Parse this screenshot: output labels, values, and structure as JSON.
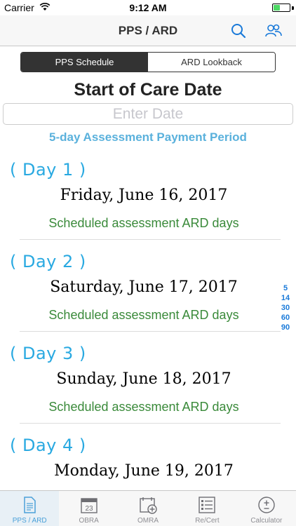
{
  "status": {
    "carrier": "Carrier",
    "time": "9:12 AM",
    "battery_level": 0.4
  },
  "nav": {
    "title": "PPS / ARD",
    "icons": [
      "search-icon",
      "people-icon"
    ]
  },
  "segments": [
    {
      "label": "PPS Schedule",
      "active": true
    },
    {
      "label": "ARD Lookback",
      "active": false
    }
  ],
  "main": {
    "title": "Start of Care Date",
    "date_placeholder": "Enter Date",
    "date_value": "",
    "period": "5-day Assessment Payment Period"
  },
  "days": [
    {
      "label": "( Day  1 )",
      "date": "Friday, June 16, 2017",
      "note": "Scheduled assessment ARD days"
    },
    {
      "label": "( Day  2 )",
      "date": "Saturday, June 17, 2017",
      "note": "Scheduled assessment ARD days"
    },
    {
      "label": "( Day  3 )",
      "date": "Sunday, June 18, 2017",
      "note": "Scheduled assessment ARD days"
    },
    {
      "label": "( Day  4 )",
      "date": "Monday, June 19, 2017",
      "note": ""
    }
  ],
  "index": [
    "5",
    "14",
    "30",
    "60",
    "90"
  ],
  "tabs": [
    {
      "label": "PPS / ARD",
      "icon": "document-icon",
      "active": true
    },
    {
      "label": "OBRA",
      "icon": "calendar-icon",
      "active": false,
      "badge": "23"
    },
    {
      "label": "OMRA",
      "icon": "calendar-add-icon",
      "active": false
    },
    {
      "label": "Re/Cert",
      "icon": "list-icon",
      "active": false
    },
    {
      "label": "Calculator",
      "icon": "plus-minus-icon",
      "active": false
    }
  ],
  "colors": {
    "accent": "#29a9e1",
    "period": "#5ab1dc",
    "scheduled": "#3a8a3a",
    "index": "#1a7ad9"
  }
}
